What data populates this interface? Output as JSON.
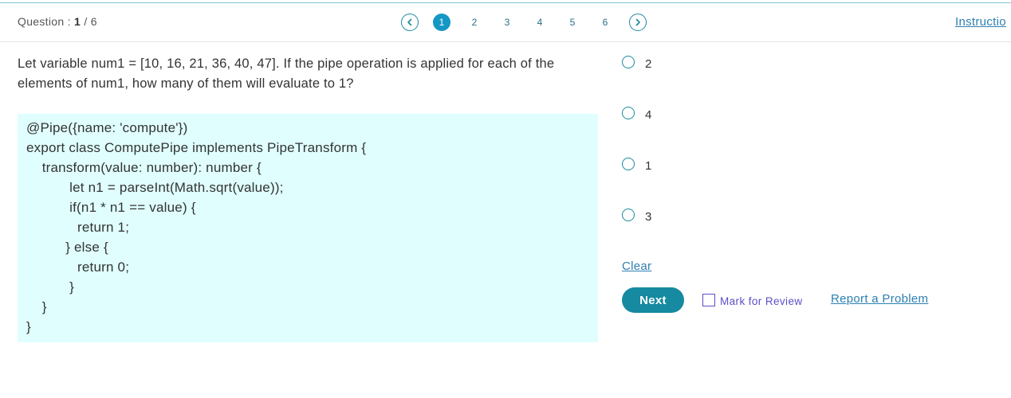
{
  "header": {
    "question_label": "Question :",
    "current": "1",
    "separator": "/",
    "total": "6",
    "pages": [
      "1",
      "2",
      "3",
      "4",
      "5",
      "6"
    ],
    "active_page": "1",
    "instructions_label": "Instructio"
  },
  "question": {
    "text": "Let variable num1 = [10, 16, 21, 36, 40, 47]. If the pipe operation is applied for each of the elements of num1, how many of them will evaluate to 1?",
    "code_lines": [
      "@Pipe({name: 'compute'})",
      "export class ComputePipe implements PipeTransform {",
      "    transform(value: number): number {",
      "           let n1 = parseInt(Math.sqrt(value));",
      "           if(n1 * n1 == value) {",
      "             return 1;",
      "          } else {",
      "             return 0;",
      "           }",
      "    }",
      "}"
    ]
  },
  "options": [
    {
      "label": "2"
    },
    {
      "label": "4"
    },
    {
      "label": "1"
    },
    {
      "label": "3"
    }
  ],
  "actions": {
    "clear_label": "Clear",
    "next_label": "Next",
    "mark_review_label": "Mark for Review",
    "report_label": "Report a Problem"
  },
  "colors": {
    "accent": "#168aa0",
    "active_page": "#1597c5",
    "code_background": "#e0fefe",
    "link": "#2d7fb3",
    "review": "#5b4fc9"
  }
}
